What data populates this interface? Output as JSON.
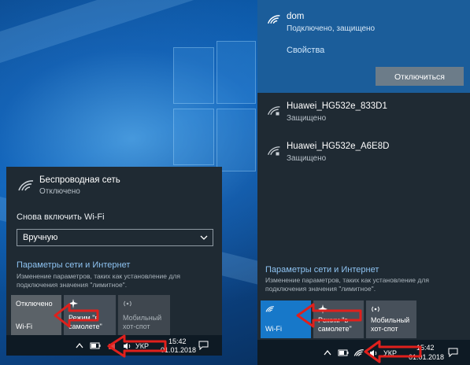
{
  "left_panel": {
    "network_name": "Беспроводная сеть",
    "network_status": "Отключено",
    "reenable_label": "Снова включить Wi-Fi",
    "reenable_select_value": "Вручную",
    "settings_link": "Параметры сети и Интернет",
    "settings_desc_line1": "Изменение параметров, таких как установление для",
    "settings_desc_line2": "подключения значения \"лимитное\".",
    "tiles": [
      {
        "top": "Отключено",
        "bottom": "Wi-Fi"
      },
      {
        "top": "",
        "bottom": "Режим \"в самолете\""
      },
      {
        "top": "",
        "bottom": "Мобильный хот-спот"
      }
    ]
  },
  "right_panel": {
    "connected": {
      "name": "dom",
      "status": "Подключено, защищено",
      "props_link": "Свойства",
      "disconnect_label": "Отключиться"
    },
    "networks": [
      {
        "name": "Huawei_HG532e_833D1",
        "status": "Защищено"
      },
      {
        "name": "Huawei_HG532e_A6E8D",
        "status": "Защищено"
      }
    ],
    "settings_link": "Параметры сети и Интернет",
    "settings_desc_line1": "Изменение параметров, таких как установление для",
    "settings_desc_line2": "подключения значения \"лимитное\".",
    "tiles": [
      {
        "top": "",
        "bottom": "Wi-Fi"
      },
      {
        "top": "",
        "bottom": "Режим \"в самолете\""
      },
      {
        "top": "",
        "bottom": "Мобильный хот-спот"
      }
    ]
  },
  "taskbar_left": {
    "lang": "УКР",
    "time": "15:42",
    "date": "01.01.2018"
  },
  "taskbar_right": {
    "lang": "УКР",
    "time": "15:42",
    "date": "01.01.2018"
  },
  "colors": {
    "accent": "#1778c9",
    "panel": "#1f2a33",
    "link": "#8ec3f2",
    "arrow": "#e0201c"
  }
}
